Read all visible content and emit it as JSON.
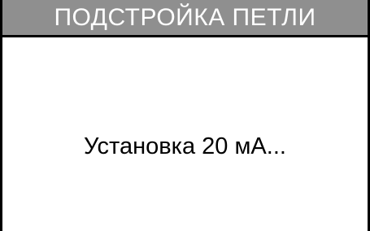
{
  "header": {
    "title": "ПОДСТРОЙКА ПЕТЛИ"
  },
  "main": {
    "status_message": "Установка 20 мА..."
  },
  "colors": {
    "title_bar_background": "#8f8f8f",
    "title_text": "#ffffff",
    "content_background": "#ffffff",
    "border": "#000000"
  }
}
